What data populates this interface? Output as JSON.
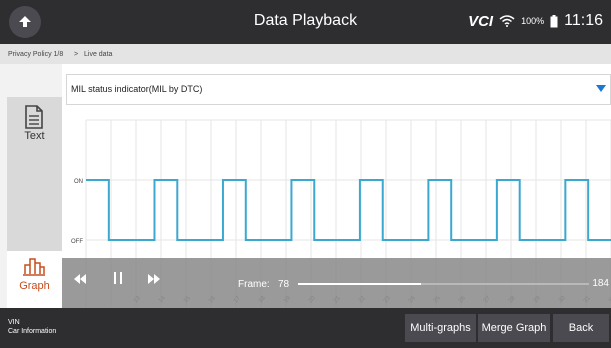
{
  "header": {
    "title": "Data Playback",
    "vci_label": "VCI",
    "battery": "100%",
    "time": "11:16"
  },
  "breadcrumb": {
    "first": "Privacy Policy 1/8",
    "sep": ">",
    "second": "Live data"
  },
  "sidebar": {
    "text_label": "Text",
    "graph_label": "Graph"
  },
  "dropdown": {
    "selected": "MIL status indicator(MIL by DTC)"
  },
  "chart_data": {
    "type": "line",
    "title": "MIL status indicator(MIL by DTC)",
    "y_categories": [
      "OFF",
      "ON"
    ],
    "x_ticks": [
      " ",
      " ",
      "13",
      "14",
      "15",
      "16",
      "17",
      "18",
      "19",
      "20",
      "21",
      "22",
      "23",
      "24",
      "25",
      "26",
      "27",
      "28",
      "29",
      "30",
      "31",
      "32"
    ],
    "series": [
      {
        "values": [
          1,
          0,
          0,
          1,
          0,
          0,
          1,
          0,
          0,
          1,
          0,
          0,
          1,
          0,
          0,
          1,
          0,
          0,
          1,
          0,
          0,
          1,
          0
        ]
      }
    ],
    "line_color": "#3aa8cf"
  },
  "playback": {
    "frame_label": "Frame:",
    "frame": 78,
    "max": 184
  },
  "footer": {
    "vin_label": "VIN",
    "car_info": "Car Information",
    "multi_graphs": "Multi-graphs",
    "merge_graph": "Merge Graph",
    "back": "Back"
  }
}
